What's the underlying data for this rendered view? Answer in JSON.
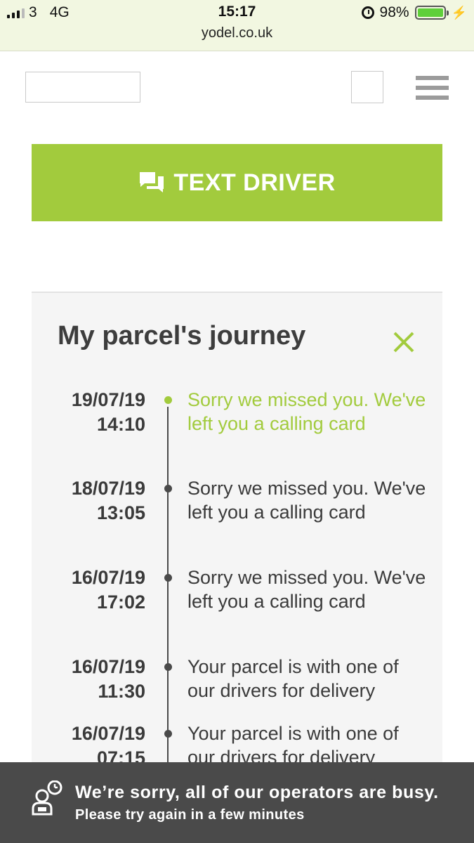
{
  "status_bar": {
    "carrier": "3",
    "network": "4G",
    "time": "15:17",
    "url": "yodel.co.uk",
    "battery": "98%"
  },
  "header": {
    "menu_icon": "hamburger-icon"
  },
  "text_driver": {
    "label": "TEXT DRIVER",
    "icon": "chat-icon",
    "color": "#a2cb3d"
  },
  "journey": {
    "title": "My parcel's journey",
    "close_icon": "close-icon",
    "entries": [
      {
        "date": "19/07/19",
        "time": "14:10",
        "message": "Sorry we missed you. We've left you a calling card",
        "current": true
      },
      {
        "date": "18/07/19",
        "time": "13:05",
        "message": "Sorry we missed you. We've left you a calling card",
        "current": false
      },
      {
        "date": "16/07/19",
        "time": "17:02",
        "message": "Sorry we missed you. We've left you a calling card",
        "current": false
      },
      {
        "date": "16/07/19",
        "time": "11:30",
        "message": "Your parcel is with one of our drivers for delivery",
        "current": false
      },
      {
        "date": "16/07/19",
        "time": "07:15",
        "message": "Your parcel is with one of our drivers for delivery",
        "current": false
      }
    ]
  },
  "banner": {
    "line1": "We’re sorry, all of our operators are busy.",
    "line2": "Please try again in a few minutes",
    "icon": "operator-busy-icon"
  }
}
